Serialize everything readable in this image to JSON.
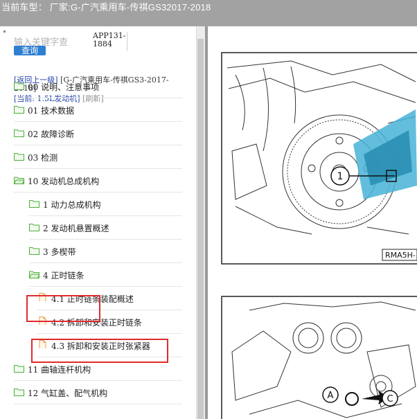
{
  "header": {
    "title": "当前车型：  厂家:G-广汽乘用车-传祺GS32017-2018"
  },
  "search": {
    "hint": "输入关键字查",
    "button": "查询",
    "code_line1": "APP131-",
    "code_line2": "1884"
  },
  "nav": {
    "back_link": "[返回上一级]",
    "path": "[G-广汽乘用车-传祺GS3-2017-2018]",
    "current_label": "[当前:",
    "current_value": "1.5L发动机]",
    "refresh": "[刷新]"
  },
  "tree": [
    {
      "label": "00 说明、注意事项",
      "type": "folder"
    },
    {
      "label": "01 技术数据",
      "type": "folder"
    },
    {
      "label": "02 故障诊断",
      "type": "folder"
    },
    {
      "label": "03 检测",
      "type": "folder"
    },
    {
      "label": "10 发动机总成机构",
      "type": "folder-open"
    },
    {
      "label": "1 动力总成机构",
      "type": "folder"
    },
    {
      "label": "2 发动机悬置概述",
      "type": "folder"
    },
    {
      "label": "3 多楔带",
      "type": "folder"
    },
    {
      "label": "4 正时链条",
      "type": "folder-open"
    },
    {
      "label": "4.1 正时链条装配概述",
      "type": "doc"
    },
    {
      "label": "4.2 拆卸和安装正时链条",
      "type": "doc"
    },
    {
      "label": "4.3 拆卸和安装正时张紧器",
      "type": "doc"
    },
    {
      "label": "11 曲轴连杆机构",
      "type": "folder"
    },
    {
      "label": "12 气缸盖、配气机构",
      "type": "folder"
    }
  ],
  "figure": {
    "callout_1": "1",
    "ref_code": "RMA5H-",
    "callout_a": "A",
    "callout_c": "C"
  },
  "colors": {
    "folder_green": "#4caf3b",
    "doc_orange": "#e8a04a",
    "link_blue": "#1f3fa8",
    "highlight_red": "#e02b2b"
  }
}
